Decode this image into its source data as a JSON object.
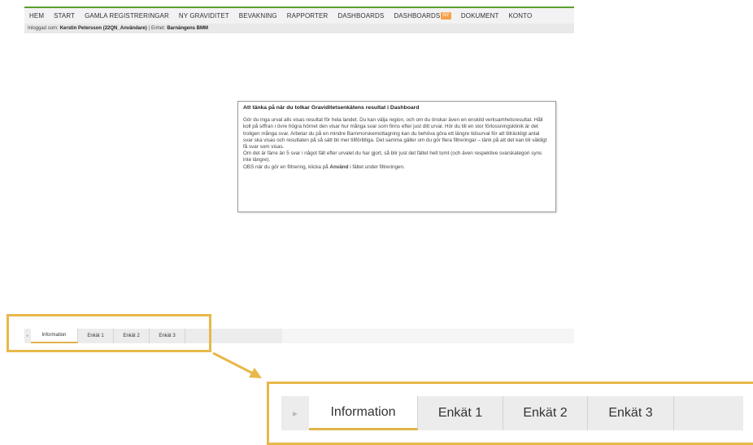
{
  "nav": {
    "items": [
      "HEM",
      "START",
      "GAMLA REGISTRERINGAR",
      "NY GRAVIDITET",
      "BEVAKNING",
      "RAPPORTER",
      "DASHBOARDS",
      "DASHBOARDS",
      "DOKUMENT",
      "KONTO"
    ],
    "new_badge": "NY"
  },
  "userbar": {
    "prefix": "Inloggad som:",
    "user": "Kerstin Petersson (22QN_Användare)",
    "unit_label": "| Enhet:",
    "unit": "Barnängens BMM"
  },
  "info": {
    "title": "Att tänka på när du tolkar Graviditetsenkätens resultat i Dashboard",
    "p1": "Gör du inga urval alls visas resultat för hela landet. Du kan välja region, och om du önskar även en enskild verksamhetsresultat. Håll koll på siffran i övre högra hörnet den visar hur många svar som finns efter just ditt urval. Hör du till en stor förlossningsklinik är det troligen många svar. Arbetar du på en mindre Barnmorskemottagning kan du behöva göra ett längre tidsurval för att tillräckligt antal svar ska visas och resultaten på så sätt bli mer tillförlitliga. Det samma gäller om du gör flera filtreringar – tänk på att det kan bli väldigt få svar som visas.",
    "p2": "Om det är färre än 5 svar i något fält efter urvalet du har gjort, så blir just det fältet helt tomt (och även respektive svarskategori syns inte längre).",
    "p3_pre": "OBS när du gör en filtrering, klicka på",
    "p3_bold": "Använd",
    "p3_post": "i fältet under filtreringen."
  },
  "tabs": [
    "Information",
    "Enkät 1",
    "Enkät 2",
    "Enkät 3"
  ],
  "colors": {
    "nav_accent": "#5aa02c",
    "highlight": "#e8b84a",
    "badge": "#f5a14a"
  },
  "icons": [
    "scroll-left-icon",
    "arrow-icon"
  ]
}
